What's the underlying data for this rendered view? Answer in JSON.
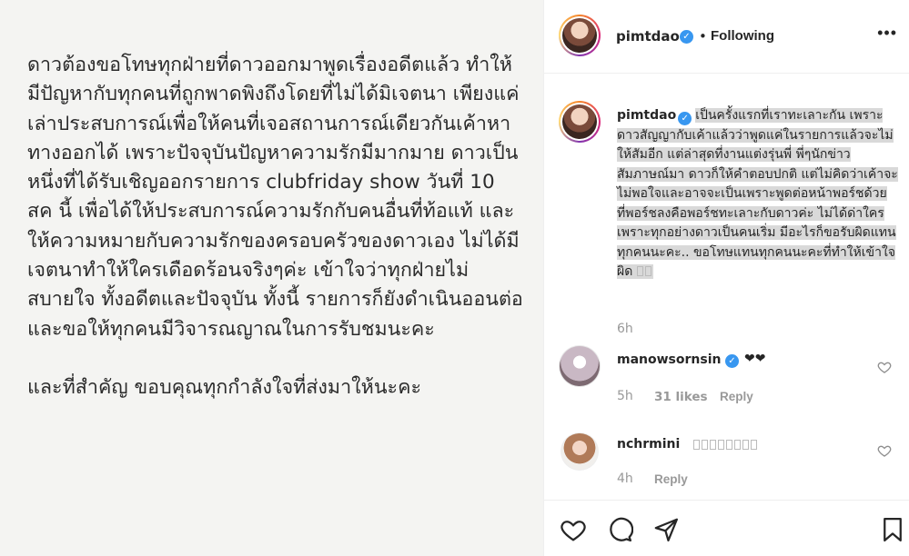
{
  "post_image": {
    "paragraphs": [
      "ดาวต้องขอโทษทุกฝ่ายที่ดาวออกมาพูดเรื่องอดีตแล้ว ทำให้มีปัญหากับทุกคนที่ถูกพาดพิงถึงโดยที่ไม่ได้มิเจตนา เพียงแค่เล่าประสบการณ์เพื่อให้คนที่เจอสถานการณ์เดียวกันเค้าหาทางออกได้ เพราะปัจจุบันปัญหาความรักมีมากมาย ดาวเป็นหนึ่งที่ได้รับเชิญออกรายการ clubfriday show วันที่ 10 สค นี้ เพื่อได้ให้ประสบการณ์ความรักกับคนอื่นที่ท้อแท้ และให้ความหมายกับความรักของครอบครัวของดาวเอง ไม่ได้มีเจตนาทำให้ใครเดือดร้อนจริงๆค่ะ เข้าใจว่าทุกฝ่ายไม่สบายใจ ทั้งอดีตและปัจจุบัน ทั้งนี้ รายการก็ยังดำเนินออนต่อ และขอให้ทุกคนมีวิจารณญาณในการรับชมนะคะ",
      "และที่สำคัญ ขอบคุณทุกกำลังใจที่ส่งมาให้นะคะ"
    ]
  },
  "header": {
    "username": "pimtdao",
    "separator": "•",
    "follow_status": "Following",
    "more": "•••"
  },
  "caption": {
    "username": "pimtdao",
    "text": "เป็นครั้งแรกที่เราทะเลาะกัน เพราะดาวสัญญากับเค้าแล้วว่าพูดแค่ในรายการแล้วจะไม่ให้สัมอีก แต่ล่าสุดที่งานแต่งรุ่นพี่ พี่ๆนักข่าวสัมภาษณ์มา ดาวก็ให้คำตอบปกติ แต่ไม่คิดว่าเค้าจะไม่พอใจและอาจจะเป็นเพราะพูดต่อหน้าพอร์ชด้วย ที่พอร์ชลงคือพอร์ชทะเลาะกับดาวค่ะ ไม่ได้ด่าใคร เพราะทุกอย่างดาวเป็นคนเริ่ม มีอะไรก็ขอรับผิดแทนทุกคนนะคะ.. ขอโทษแทนทุกคนนะคะที่ทำให้เข้าใจผิด",
    "time": "6h"
  },
  "comments": [
    {
      "username": "manowsornsin",
      "text": "❤❤",
      "time": "5h",
      "likes": "31 likes",
      "reply": "Reply"
    },
    {
      "username": "nchrmini",
      "text": "",
      "time": "4h",
      "reply": "Reply"
    }
  ],
  "icons": {
    "like": "heart-icon",
    "comment": "comment-icon",
    "share": "share-icon",
    "save": "bookmark-icon"
  },
  "colors": {
    "verified": "#3897f0",
    "highlight": "#d9d9d9",
    "muted": "#999999"
  }
}
